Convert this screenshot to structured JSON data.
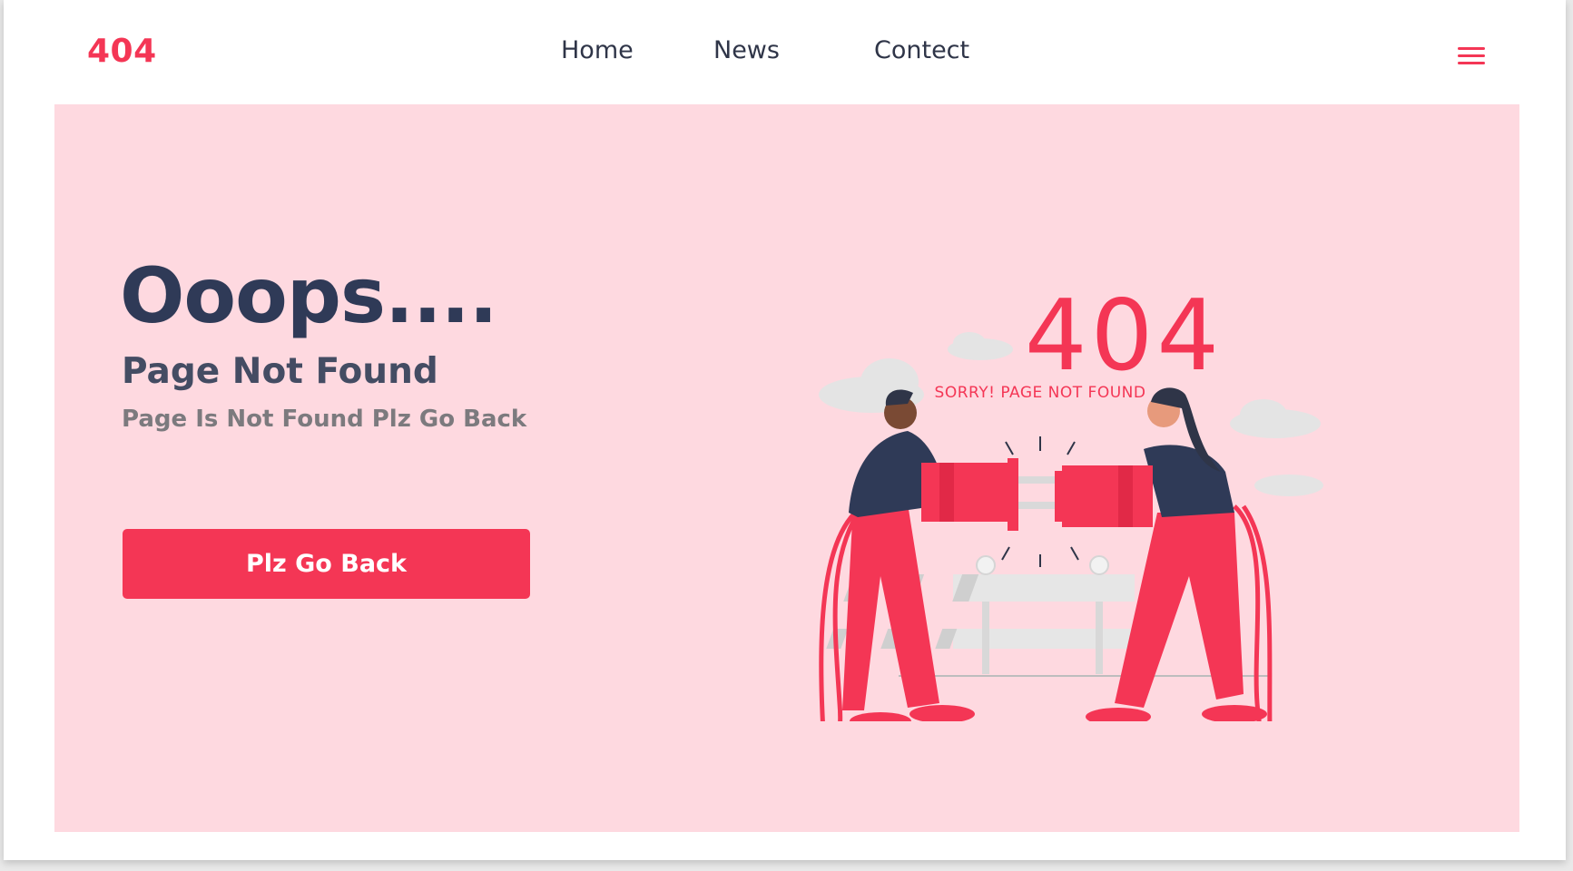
{
  "header": {
    "logo": "404",
    "nav": [
      "Home",
      "News",
      "Contect"
    ]
  },
  "hero": {
    "headline": "Ooops....",
    "title": "Page Not Found",
    "subtitle": "Page Is Not Found Plz Go Back",
    "button_label": "Plz Go Back"
  },
  "illustration": {
    "code": "404",
    "caption": "SORRY! PAGE NOT FOUND"
  },
  "icons": [
    "menu-icon"
  ],
  "colors": {
    "accent": "#f43655",
    "hero_bg": "#fed9e0",
    "heading": "#2f3a57",
    "muted": "#7c7a7e"
  }
}
